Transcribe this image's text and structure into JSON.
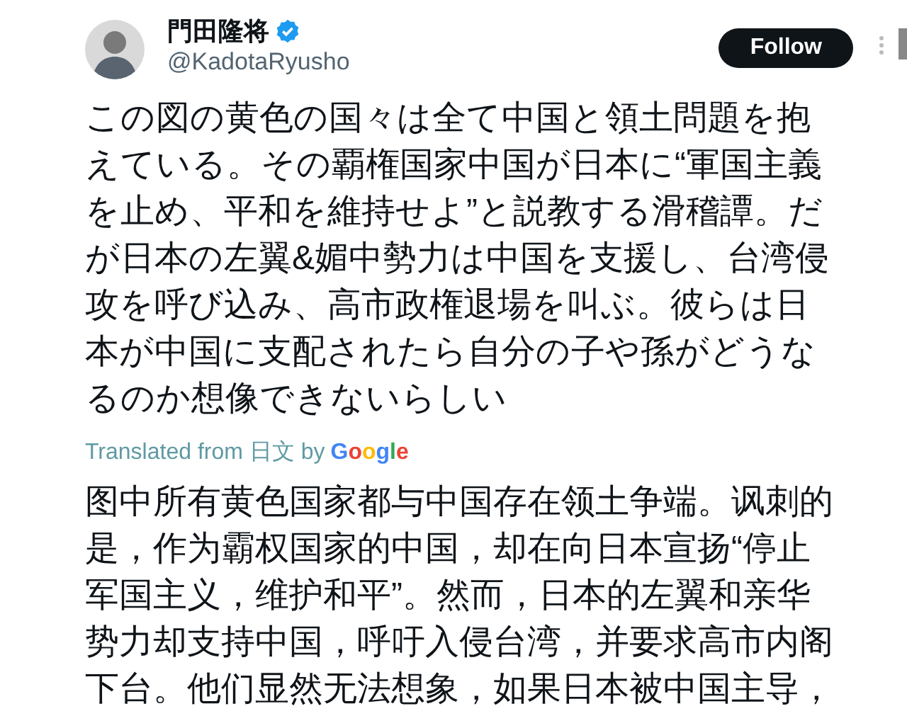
{
  "author": {
    "name": "門田隆将",
    "verified": true,
    "handle": "@KadotaRyusho"
  },
  "follow_button": "Follow",
  "post_text": "この図の黄色の国々は全て中国と領土問題を抱えている。その覇権国家中国が日本に“軍国主義を止め、平和を維持せよ”と説教する滑稽譚。だが日本の左翼&媚中勢力は中国を支援し、台湾侵攻を呼び込み、高市政権退場を叫ぶ。彼らは日本が中国に支配されたら自分の子や孫がどうなるのか想像できないらしい",
  "translation": {
    "label": "Translated from 日文 by",
    "provider": "Google",
    "text": "图中所有黄色国家都与中国存在领土争端。讽刺的是，作为霸权国家的中国，却在向日本宣扬“停止军国主义，维护和平”。然而，日本的左翼和亲华势力却支持中国，呼吁入侵台湾，并要求高市内阁下台。他们显然无法想象，如果日本被中国主导，"
  }
}
